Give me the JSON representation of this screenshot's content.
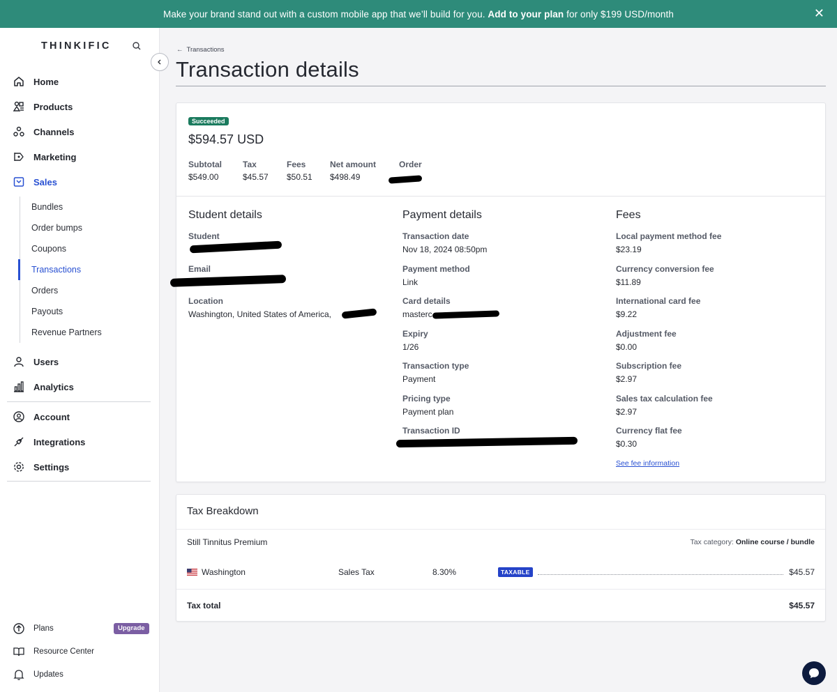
{
  "banner": {
    "text_before": "Make your brand stand out with a custom mobile app that we’ll build for you.",
    "cta": "Add to your plan",
    "text_after": "for only $199 USD/month"
  },
  "sidebar": {
    "logo": "THINKIFIC",
    "nav": [
      {
        "label": "Home",
        "icon": "home-icon"
      },
      {
        "label": "Products",
        "icon": "products-icon"
      },
      {
        "label": "Channels",
        "icon": "channels-icon"
      },
      {
        "label": "Marketing",
        "icon": "marketing-icon"
      },
      {
        "label": "Sales",
        "icon": "sales-icon"
      }
    ],
    "sales_sub": [
      "Bundles",
      "Order bumps",
      "Coupons",
      "Transactions",
      "Orders",
      "Payouts",
      "Revenue Partners"
    ],
    "nav2": [
      {
        "label": "Users",
        "icon": "users-icon"
      },
      {
        "label": "Analytics",
        "icon": "analytics-icon"
      }
    ],
    "nav3": [
      {
        "label": "Account",
        "icon": "account-icon"
      },
      {
        "label": "Integrations",
        "icon": "integrations-icon"
      },
      {
        "label": "Settings",
        "icon": "settings-icon"
      }
    ],
    "footer": [
      {
        "label": "Plans",
        "icon": "plans-icon"
      },
      {
        "label": "Resource Center",
        "icon": "book-icon"
      },
      {
        "label": "Updates",
        "icon": "bell-icon"
      }
    ],
    "upgrade_badge": "Upgrade"
  },
  "breadcrumb": "Transactions",
  "page_title": "Transaction details",
  "summary": {
    "status": "Succeeded",
    "amount": "$594.57 USD",
    "subtotal_label": "Subtotal",
    "subtotal": "$549.00",
    "tax_label": "Tax",
    "tax": "$45.57",
    "fees_label": "Fees",
    "fees": "$50.51",
    "net_label": "Net amount",
    "net": "$498.49",
    "order_label": "Order"
  },
  "student": {
    "heading": "Student details",
    "student_label": "Student",
    "email_label": "Email",
    "location_label": "Location",
    "location": "Washington, United States of America,"
  },
  "payment": {
    "heading": "Payment details",
    "date_label": "Transaction date",
    "date": "Nov 18, 2024 08:50pm",
    "method_label": "Payment method",
    "method": "Link",
    "card_label": "Card details",
    "card": "masterc",
    "expiry_label": "Expiry",
    "expiry": "1/26",
    "type_label": "Transaction type",
    "type": "Payment",
    "pricing_label": "Pricing type",
    "pricing": "Payment plan",
    "id_label": "Transaction ID"
  },
  "fees": {
    "heading": "Fees",
    "items": [
      {
        "label": "Local payment method fee",
        "value": "$23.19"
      },
      {
        "label": "Currency conversion fee",
        "value": "$11.89"
      },
      {
        "label": "International card fee",
        "value": "$9.22"
      },
      {
        "label": "Adjustment fee",
        "value": "$0.00"
      },
      {
        "label": "Subscription fee",
        "value": "$2.97"
      },
      {
        "label": "Sales tax calculation fee",
        "value": "$2.97"
      },
      {
        "label": "Currency flat fee",
        "value": "$0.30"
      }
    ],
    "link": "See fee information"
  },
  "tax": {
    "heading": "Tax Breakdown",
    "product": "Still Tinnitus Premium",
    "category_label": "Tax category:",
    "category": "Online course / bundle",
    "row": {
      "region": "Washington",
      "tax_name": "Sales Tax",
      "rate": "8.30%",
      "badge": "TAXABLE",
      "amount": "$45.57"
    },
    "total_label": "Tax total",
    "total": "$45.57"
  },
  "colors": {
    "banner": "#2e8b7a",
    "accent": "#2850d2",
    "success": "#1b7b5e",
    "upgrade": "#7b5ea3"
  }
}
